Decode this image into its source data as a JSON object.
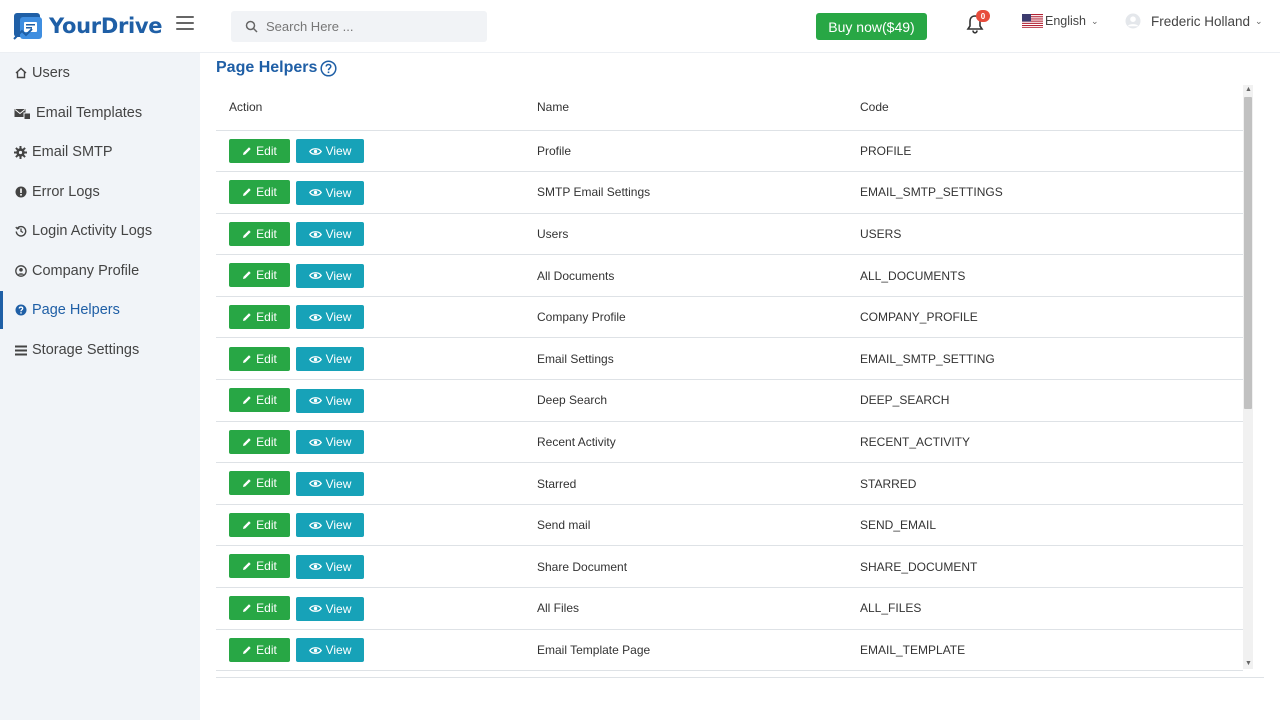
{
  "app": {
    "name": "YourDrive"
  },
  "search": {
    "placeholder": "Search Here ..."
  },
  "header": {
    "buy_label": "Buy now($49)",
    "notification_count": "0",
    "language": "English",
    "user_name": "Frederic Holland"
  },
  "sidebar": {
    "items": [
      {
        "label": "Users",
        "icon": "home-icon"
      },
      {
        "label": "Email Templates",
        "icon": "email-templates-icon"
      },
      {
        "label": "Email SMTP",
        "icon": "gear-icon"
      },
      {
        "label": "Error Logs",
        "icon": "exclamation-circle-icon"
      },
      {
        "label": "Login Activity Logs",
        "icon": "history-icon"
      },
      {
        "label": "Company Profile",
        "icon": "user-circle-icon"
      },
      {
        "label": "Page Helpers",
        "icon": "question-circle-icon",
        "active": true
      },
      {
        "label": "Storage Settings",
        "icon": "list-icon"
      }
    ]
  },
  "page": {
    "title": "Page Helpers"
  },
  "table": {
    "headers": {
      "action": "Action",
      "name": "Name",
      "code": "Code"
    },
    "edit_label": "Edit",
    "view_label": "View",
    "rows": [
      {
        "name": "Profile",
        "code": "PROFILE"
      },
      {
        "name": "SMTP Email Settings",
        "code": "EMAIL_SMTP_SETTINGS"
      },
      {
        "name": "Users",
        "code": "USERS"
      },
      {
        "name": "All Documents",
        "code": "ALL_DOCUMENTS"
      },
      {
        "name": "Company Profile",
        "code": "COMPANY_PROFILE"
      },
      {
        "name": "Email Settings",
        "code": "EMAIL_SMTP_SETTING"
      },
      {
        "name": "Deep Search",
        "code": "DEEP_SEARCH"
      },
      {
        "name": "Recent Activity",
        "code": "RECENT_ACTIVITY"
      },
      {
        "name": "Starred",
        "code": "STARRED"
      },
      {
        "name": "Send mail",
        "code": "SEND_EMAIL"
      },
      {
        "name": "Share Document",
        "code": "SHARE_DOCUMENT"
      },
      {
        "name": "All Files",
        "code": "ALL_FILES"
      },
      {
        "name": "Email Template Page",
        "code": "EMAIL_TEMPLATE"
      }
    ]
  },
  "colors": {
    "brand": "#1f5fa6",
    "success": "#28a745",
    "info": "#17a2b8",
    "danger": "#e74c3c",
    "sidebar_bg": "#f1f4f8"
  }
}
